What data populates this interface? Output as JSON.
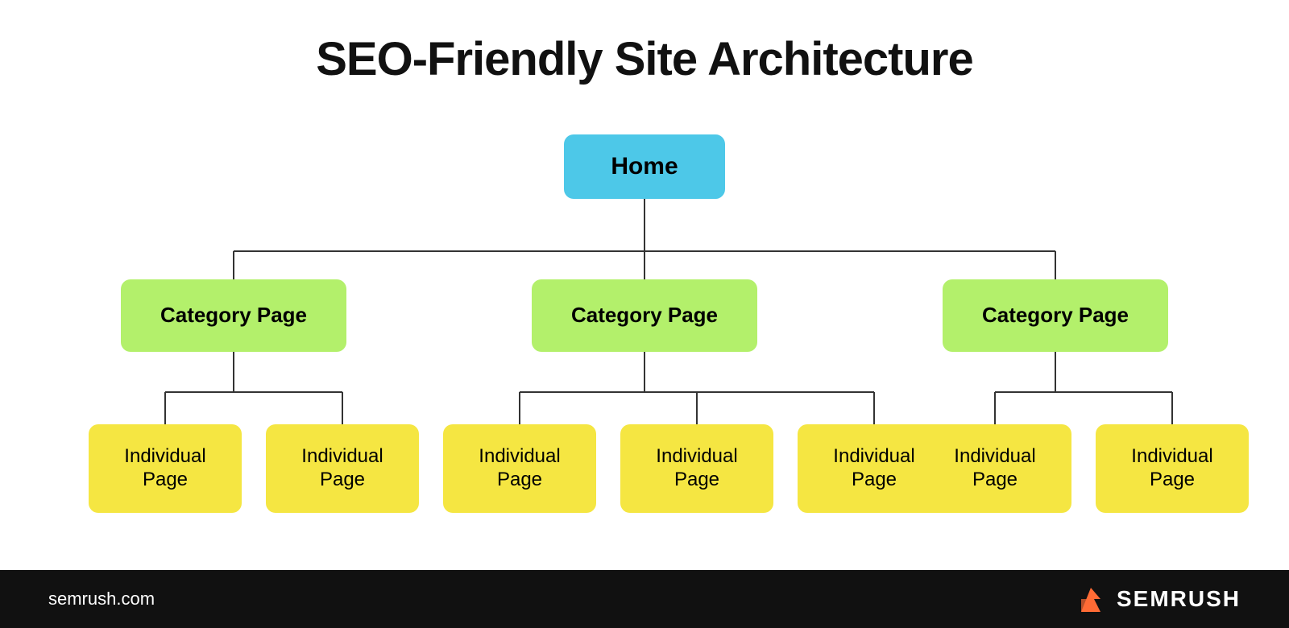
{
  "title": "SEO-Friendly Site Architecture",
  "nodes": {
    "home": "Home",
    "category1": "Category Page",
    "category2": "Category Page",
    "category3": "Category Page",
    "individual": "Individual\nPage"
  },
  "individual_pages": [
    {
      "id": "ind-1-1",
      "label": "Individual\nPage"
    },
    {
      "id": "ind-1-2",
      "label": "Individual\nPage"
    },
    {
      "id": "ind-2-1",
      "label": "Individual\nPage"
    },
    {
      "id": "ind-2-2",
      "label": "Individual\nPage"
    },
    {
      "id": "ind-2-3",
      "label": "Individual\nPage"
    },
    {
      "id": "ind-3-1",
      "label": "Individual\nPage"
    },
    {
      "id": "ind-3-2",
      "label": "Individual\nPage"
    }
  ],
  "footer": {
    "url": "semrush.com",
    "brand": "SEMRUSH"
  },
  "colors": {
    "home": "#4dc8e8",
    "category": "#b3f06b",
    "individual": "#f5e642",
    "background": "#ffffff",
    "footer_bg": "#111111",
    "footer_text": "#ffffff",
    "line_color": "#333333"
  }
}
